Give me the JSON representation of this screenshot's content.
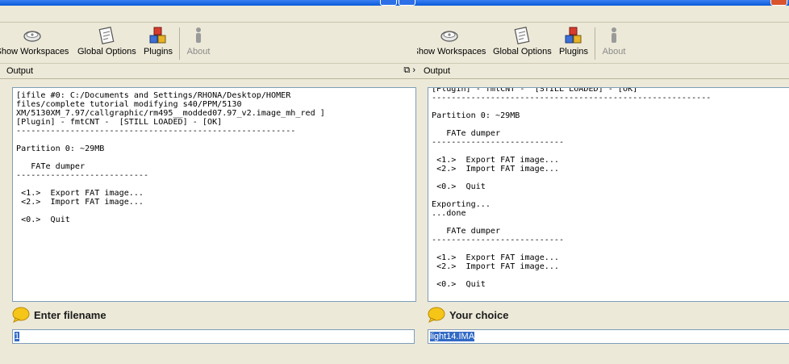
{
  "left": {
    "toolbar": {
      "show_workspaces": "Show Workspaces",
      "global_options": "Global Options",
      "plugins": "Plugins",
      "about": "About"
    },
    "output_header": "Output",
    "console_text": "[ifile #0: C:/Documents and Settings/RHONA/Desktop/HOMER\nfiles/complete tutorial modifying s40/PPM/5130\nXM/5130XM_7.97/callgraphic/rm495__modded07.97_v2.image_mh_red ]\n[Plugin] - fmtCNT -  [STILL LOADED] - [OK]\n---------------------------------------------------------\n\nPartition 0: ~29MB\n\n   FATe dumper\n---------------------------\n\n <1.>  Export FAT image...\n <2.>  Import FAT image...\n\n <0.>  Quit",
    "prompt_text": "Enter filename",
    "input_value": "1"
  },
  "right": {
    "toolbar": {
      "show_workspaces": "Show Workspaces",
      "global_options": "Global Options",
      "plugins": "Plugins",
      "about": "About"
    },
    "output_header": "Output",
    "console_text": "[Plugin] - fmtCNT -  [STILL LOADED] - [OK]\n---------------------------------------------------------\n\nPartition 0: ~29MB\n\n   FATe dumper\n---------------------------\n\n <1.>  Export FAT image...\n <2.>  Import FAT image...\n\n <0.>  Quit\n\nExporting...\n...done\n\n   FATe dumper\n---------------------------\n\n <1.>  Export FAT image...\n <2.>  Import FAT image...\n\n <0.>  Quit",
    "prompt_text": "Your choice",
    "input_value": "light14.IMA"
  }
}
